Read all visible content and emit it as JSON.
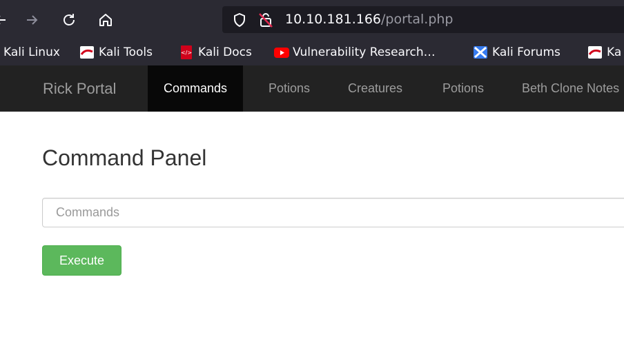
{
  "browser": {
    "url_host": "10.10.181.166",
    "url_path": "/portal.php",
    "icons": {
      "back": "back-arrow-icon",
      "forward": "forward-arrow-icon",
      "reload": "reload-icon",
      "home": "home-icon",
      "shield": "shield-icon",
      "lock": "insecure-lock-icon"
    }
  },
  "bookmarks": [
    {
      "label": "Kali Linux",
      "icon": "kali-icon"
    },
    {
      "label": "Kali Tools",
      "icon": "kali-icon"
    },
    {
      "label": "Kali Docs",
      "icon": "kali-docs-icon"
    },
    {
      "label": "Vulnerability Research…",
      "icon": "youtube-icon"
    },
    {
      "label": "Kali Forums",
      "icon": "kali-forums-icon"
    },
    {
      "label": "Ka",
      "icon": "kali-icon"
    }
  ],
  "site": {
    "brand": "Rick Portal",
    "nav": [
      "Commands",
      "Potions",
      "Creatures",
      "Potions",
      "Beth Clone Notes"
    ],
    "active_nav": "Commands"
  },
  "panel": {
    "title": "Command Panel",
    "input_placeholder": "Commands",
    "input_value": "",
    "button_label": "Execute"
  },
  "colors": {
    "toolbar_bg": "#2b2a33",
    "navbar_bg": "#222222",
    "nav_active_bg": "#080808",
    "button_green": "#5cb85c"
  }
}
